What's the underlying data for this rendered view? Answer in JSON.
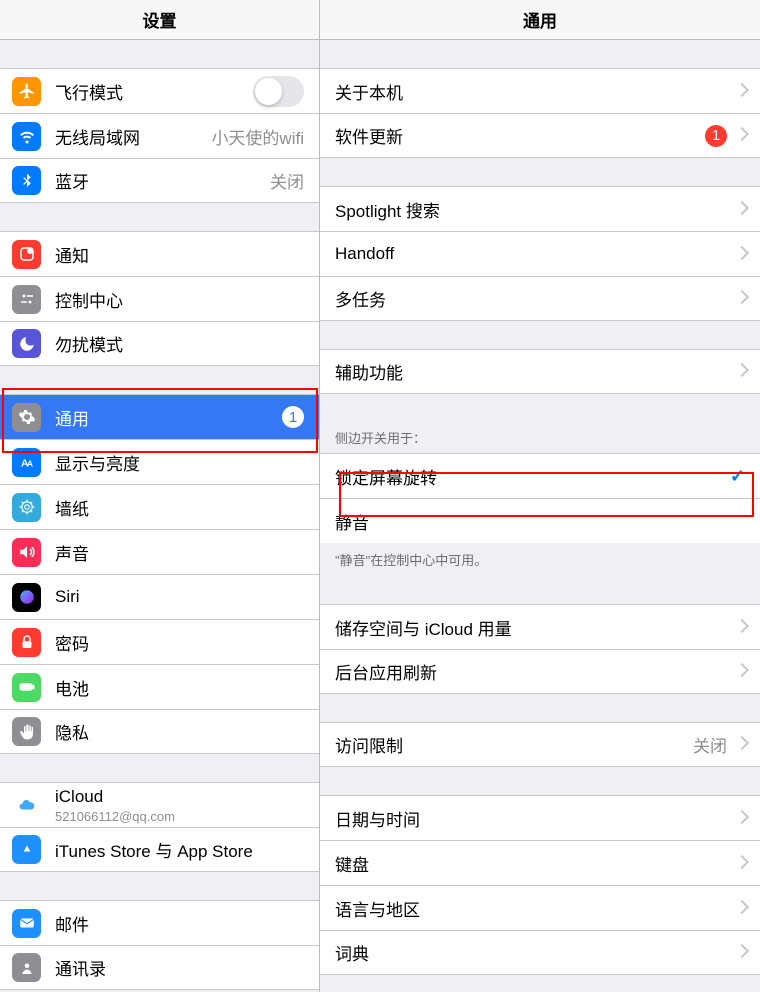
{
  "sidebar": {
    "title": "设置",
    "groups": [
      {
        "items": [
          {
            "icon": "airplane",
            "color": "#ff9500",
            "label": "飞行模式",
            "accessory": "toggle"
          },
          {
            "icon": "wifi",
            "color": "#007aff",
            "label": "无线局域网",
            "value": "小天使的wifi"
          },
          {
            "icon": "bluetooth",
            "color": "#007aff",
            "label": "蓝牙",
            "value": "关闭"
          }
        ]
      },
      {
        "items": [
          {
            "icon": "notification",
            "color": "#ff3b30",
            "label": "通知"
          },
          {
            "icon": "control",
            "color": "#8e8e93",
            "label": "控制中心"
          },
          {
            "icon": "moon",
            "color": "#5856d6",
            "label": "勿扰模式"
          }
        ]
      },
      {
        "items": [
          {
            "icon": "gear",
            "color": "#8e8e93",
            "label": "通用",
            "badge": "1",
            "selected": true
          },
          {
            "icon": "display",
            "color": "#007aff",
            "label": "显示与亮度"
          },
          {
            "icon": "wallpaper",
            "color": "#34aadc",
            "label": "墙纸"
          },
          {
            "icon": "sound",
            "color": "#ff2d55",
            "label": "声音"
          },
          {
            "icon": "siri",
            "color": "#000000",
            "label": "Siri"
          },
          {
            "icon": "lock",
            "color": "#ff3b30",
            "label": "密码"
          },
          {
            "icon": "battery",
            "color": "#4cd964",
            "label": "电池"
          },
          {
            "icon": "hand",
            "color": "#8e8e93",
            "label": "隐私"
          }
        ]
      },
      {
        "items": [
          {
            "icon": "cloud",
            "color": "#ffffff",
            "label": "iCloud",
            "sub": "521066112@qq.com"
          },
          {
            "icon": "appstore",
            "color": "#1e90ff",
            "label": "iTunes Store 与 App Store"
          }
        ]
      },
      {
        "items": [
          {
            "icon": "mail",
            "color": "#1e90ff",
            "label": "邮件"
          },
          {
            "icon": "contacts",
            "color": "#8e8e93",
            "label": "通讯录"
          }
        ]
      }
    ]
  },
  "detail": {
    "title": "通用",
    "groups": [
      {
        "items": [
          {
            "label": "关于本机",
            "chevron": true
          },
          {
            "label": "软件更新",
            "badge": "1",
            "chevron": true
          }
        ]
      },
      {
        "items": [
          {
            "label": "Spotlight 搜索",
            "chevron": true
          },
          {
            "label": "Handoff",
            "chevron": true
          },
          {
            "label": "多任务",
            "chevron": true
          }
        ]
      },
      {
        "items": [
          {
            "label": "辅助功能",
            "chevron": true
          }
        ]
      },
      {
        "header": "侧边开关用于：",
        "footer": "\"静音\"在控制中心中可用。",
        "items": [
          {
            "label": "锁定屏幕旋转",
            "check": true
          },
          {
            "label": "静音"
          }
        ]
      },
      {
        "items": [
          {
            "label": "储存空间与 iCloud 用量",
            "chevron": true
          },
          {
            "label": "后台应用刷新",
            "chevron": true
          }
        ]
      },
      {
        "items": [
          {
            "label": "访问限制",
            "value": "关闭",
            "chevron": true
          }
        ]
      },
      {
        "items": [
          {
            "label": "日期与时间",
            "chevron": true
          },
          {
            "label": "键盘",
            "chevron": true
          },
          {
            "label": "语言与地区",
            "chevron": true
          },
          {
            "label": "词典",
            "chevron": true
          }
        ]
      }
    ]
  }
}
